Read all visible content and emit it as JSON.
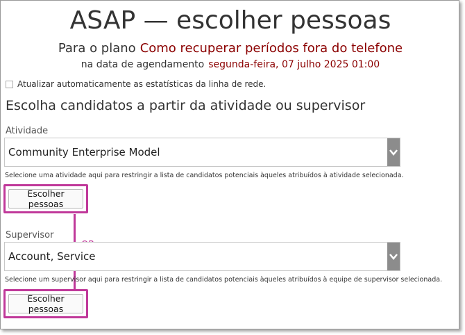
{
  "header": {
    "title": "ASAP — escolher pessoas",
    "plan_prefix": "Para o plano",
    "plan_name": "Como recuperar períodos fora do telefone",
    "date_prefix": "na data de agendamento",
    "date_value": "segunda-feira, 07 julho 2025 01:00"
  },
  "auto_update": {
    "label": "Atualizar automaticamente as estatísticas da linha de rede.",
    "checked": false
  },
  "section_heading": "Escolha candidatos a partir da atividade ou supervisor",
  "activity": {
    "label": "Atividade",
    "selected": "Community Enterprise Model",
    "help": "Selecione uma atividade aqui para restringir a lista de candidatos potenciais àqueles atribuídos à atividade selecionada.",
    "button_label": "Escolher pessoas"
  },
  "supervisor": {
    "label": "Supervisor",
    "selected": "Account, Service",
    "help": "Selecione um supervisor aqui para restringir a lista de candidatos potenciais àqueles atribuídos à equipe de supervisor selecionada.",
    "button_label": "Escolher pessoas"
  },
  "annotation": {
    "or_label": "OR",
    "highlight_color": "#c0399a"
  },
  "colors": {
    "accent_red": "#8b0000",
    "dropdown_arrow_bg": "#8c8c8c"
  },
  "icons": [
    "chevron-down-icon",
    "checkbox-icon"
  ]
}
